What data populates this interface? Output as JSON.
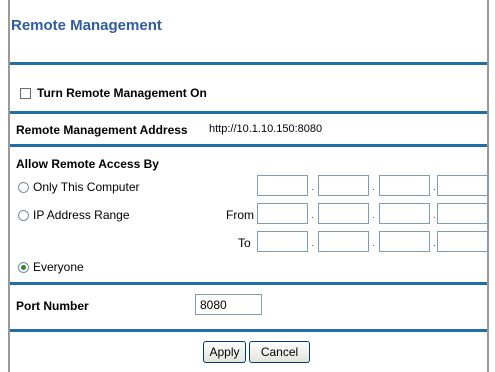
{
  "page_title": "Remote Management",
  "turn_on": {
    "label": "Turn Remote Management On",
    "checked": false
  },
  "address": {
    "label": "Remote Management Address",
    "value": "http://10.1.10.150:8080"
  },
  "access": {
    "heading": "Allow Remote Access By",
    "only_this_computer": "Only This Computer",
    "ip_range": "IP Address Range",
    "from_label": "From",
    "to_label": "To",
    "everyone": "Everyone",
    "selected": "everyone"
  },
  "port": {
    "label": "Port Number",
    "value": "8080"
  },
  "buttons": {
    "apply": "Apply",
    "cancel": "Cancel"
  },
  "colors": {
    "title": "#2f5da0",
    "rule": "#1f6ea8",
    "radio_selected": "#2d8a2d"
  }
}
